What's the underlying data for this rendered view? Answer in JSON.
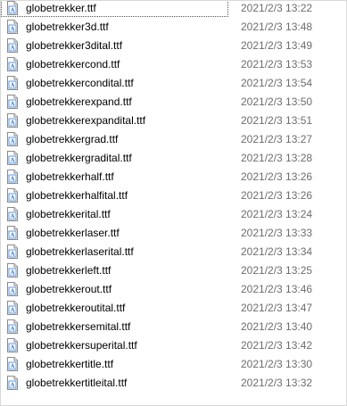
{
  "files": [
    {
      "name": "globetrekker.ttf",
      "modified": "2021/2/3 13:22",
      "icon": "font-file-icon"
    },
    {
      "name": "globetrekker3d.ttf",
      "modified": "2021/2/3 13:48",
      "icon": "font-file-icon"
    },
    {
      "name": "globetrekker3dital.ttf",
      "modified": "2021/2/3 13:49",
      "icon": "font-file-icon"
    },
    {
      "name": "globetrekkercond.ttf",
      "modified": "2021/2/3 13:53",
      "icon": "font-file-icon"
    },
    {
      "name": "globetrekkercondital.ttf",
      "modified": "2021/2/3 13:54",
      "icon": "font-file-icon"
    },
    {
      "name": "globetrekkerexpand.ttf",
      "modified": "2021/2/3 13:50",
      "icon": "font-file-icon"
    },
    {
      "name": "globetrekkerexpandital.ttf",
      "modified": "2021/2/3 13:51",
      "icon": "font-file-icon"
    },
    {
      "name": "globetrekkergrad.ttf",
      "modified": "2021/2/3 13:27",
      "icon": "font-file-icon"
    },
    {
      "name": "globetrekkergradital.ttf",
      "modified": "2021/2/3 13:28",
      "icon": "font-file-icon"
    },
    {
      "name": "globetrekkerhalf.ttf",
      "modified": "2021/2/3 13:26",
      "icon": "font-file-icon"
    },
    {
      "name": "globetrekkerhalfital.ttf",
      "modified": "2021/2/3 13:26",
      "icon": "font-file-icon"
    },
    {
      "name": "globetrekkerital.ttf",
      "modified": "2021/2/3 13:24",
      "icon": "font-file-icon"
    },
    {
      "name": "globetrekkerlaser.ttf",
      "modified": "2021/2/3 13:33",
      "icon": "font-file-icon"
    },
    {
      "name": "globetrekkerlaserital.ttf",
      "modified": "2021/2/3 13:34",
      "icon": "font-file-icon"
    },
    {
      "name": "globetrekkerleft.ttf",
      "modified": "2021/2/3 13:25",
      "icon": "font-file-icon"
    },
    {
      "name": "globetrekkerout.ttf",
      "modified": "2021/2/3 13:46",
      "icon": "font-file-icon"
    },
    {
      "name": "globetrekkeroutital.ttf",
      "modified": "2021/2/3 13:47",
      "icon": "font-file-icon"
    },
    {
      "name": "globetrekkersemital.ttf",
      "modified": "2021/2/3 13:40",
      "icon": "font-file-icon"
    },
    {
      "name": "globetrekkersuperital.ttf",
      "modified": "2021/2/3 13:42",
      "icon": "font-file-icon"
    },
    {
      "name": "globetrekkertitle.ttf",
      "modified": "2021/2/3 13:30",
      "icon": "font-file-icon"
    },
    {
      "name": "globetrekkertitleital.ttf",
      "modified": "2021/2/3 13:32",
      "icon": "font-file-icon"
    }
  ],
  "colors": {
    "text": "#000000",
    "date_text": "#6d6d6d",
    "border": "#d9d9d9",
    "icon_accent": "#3c7fd3"
  }
}
